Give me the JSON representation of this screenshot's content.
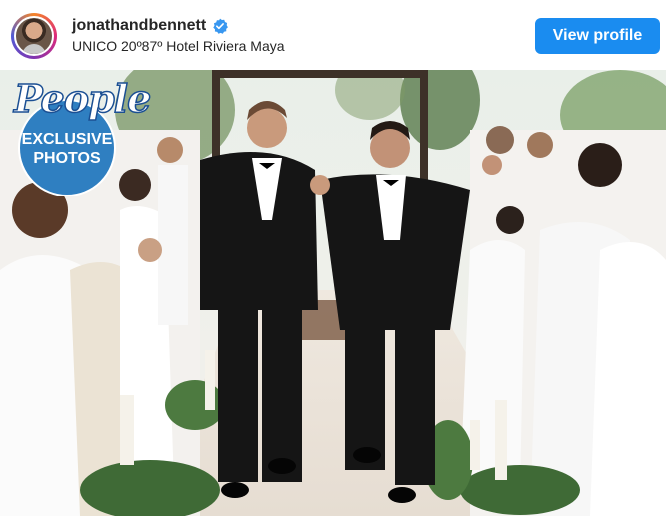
{
  "post": {
    "username": "jonathandbennett",
    "location": "UNICO 20º87º Hotel Riviera Maya",
    "view_profile_label": "View profile",
    "verified_icon": "verified-badge-icon"
  },
  "photo": {
    "badge_brand": "People",
    "badge_line1": "EXCLUSIVE",
    "badge_line2": "PHOTOS"
  },
  "colors": {
    "button_blue": "#1a8cf0",
    "verified_blue": "#3897f0",
    "badge_blue": "#2f7fc1"
  }
}
